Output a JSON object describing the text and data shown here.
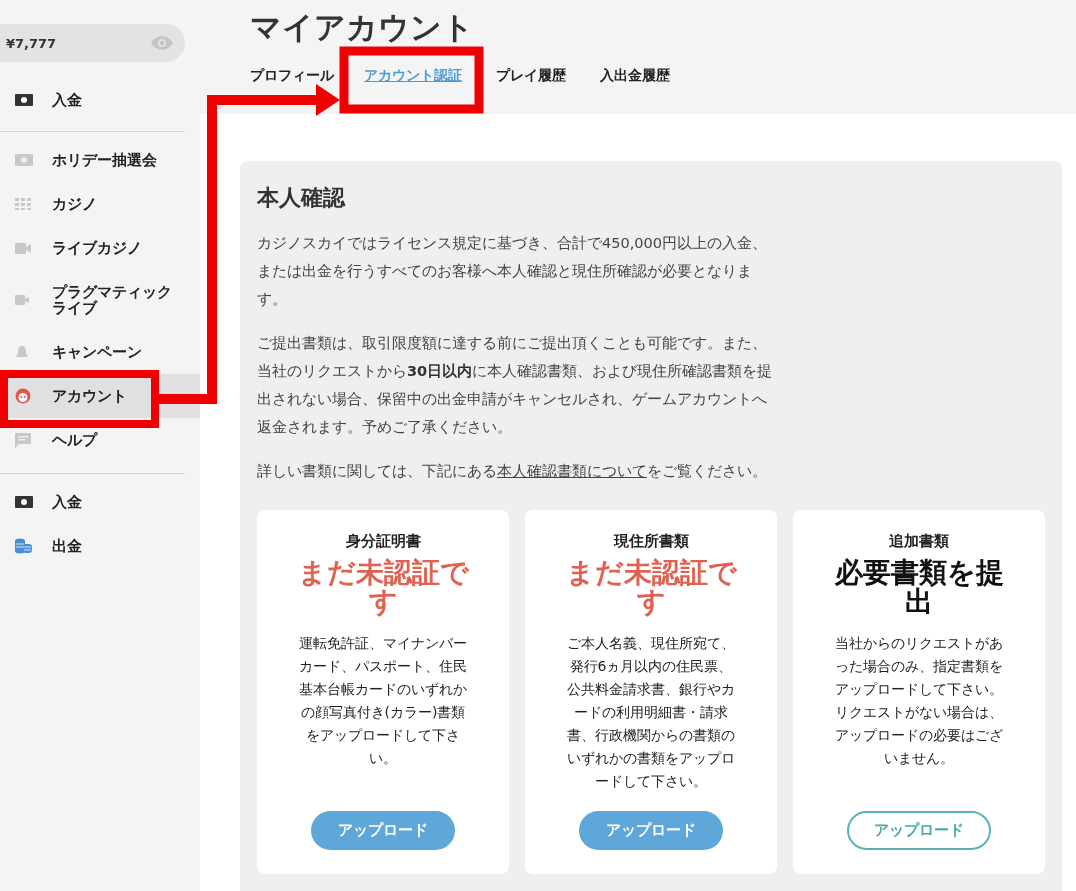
{
  "sidebar": {
    "balance": {
      "amount": "¥7,777"
    },
    "sections": [
      [
        {
          "label": "入金",
          "selected": false
        }
      ],
      [
        {
          "label": "ホリデー抽選会",
          "selected": false
        },
        {
          "label": "カジノ",
          "selected": false
        },
        {
          "label": "ライブカジノ",
          "selected": false
        },
        {
          "label": "プラグマティックライブ",
          "selected": false
        },
        {
          "label": "キャンペーン",
          "selected": false
        },
        {
          "label": "アカウント",
          "selected": true
        },
        {
          "label": "ヘルプ",
          "selected": false
        }
      ],
      [
        {
          "label": "入金",
          "selected": false
        },
        {
          "label": "出金",
          "selected": false
        }
      ]
    ]
  },
  "page": {
    "title": "マイアカウント",
    "tabs": [
      {
        "label": "プロフィール",
        "selected": false
      },
      {
        "label": "アカウント認証",
        "selected": true
      },
      {
        "label": "プレイ履歴",
        "selected": false
      },
      {
        "label": "入出金履歴",
        "selected": false
      }
    ]
  },
  "verification": {
    "heading": "本人確認",
    "paragraphs": [
      "カジノスカイではライセンス規定に基づき、合計で450,000円以上の入金、または出金を行うすべてのお客様へ本人確認と現住所確認が必要となります。",
      "ご提出書類は、取引限度額に達する前にご提出頂くことも可能です。また、当社のリクエストから**30日以内**に本人確認書類、および現住所確認書類を提出されない場合、保留中の出金申請がキャンセルされ、ゲームアカウントへ返金されます。予めご了承ください。"
    ],
    "note": {
      "before": "詳しい書類に関しては、下記にある",
      "link": "本人確認書類について",
      "after": "をご覧ください。"
    },
    "cards": [
      {
        "title": "身分証明書",
        "status": "まだ未認証です",
        "kind": "unverified",
        "description": "運転免許証、マイナンバーカード、パスポート、住民基本台帳カードのいずれかの顔写真付き(カラー)書類をアップロードして下さい。",
        "button": {
          "label": "アップロード",
          "kind": "filled"
        }
      },
      {
        "title": "現住所書類",
        "status": "まだ未認証です",
        "kind": "unverified",
        "description": "ご本人名義、現住所宛て、発行6ヵ月以内の住民票、公共料金請求書、銀行やカードの利用明細書・請求書、行政機関からの書類のいずれかの書類をアップロードして下さい。",
        "button": {
          "label": "アップロード",
          "kind": "filled"
        }
      },
      {
        "title": "追加書類",
        "status": "必要書類を提出",
        "kind": "required",
        "description": "当社からのリクエストがあった場合のみ、指定書類をアップロードして下さい。リクエストがない場合は、アップロードの必要はございません。",
        "button": {
          "label": "アップロード",
          "kind": "outline"
        }
      }
    ]
  }
}
